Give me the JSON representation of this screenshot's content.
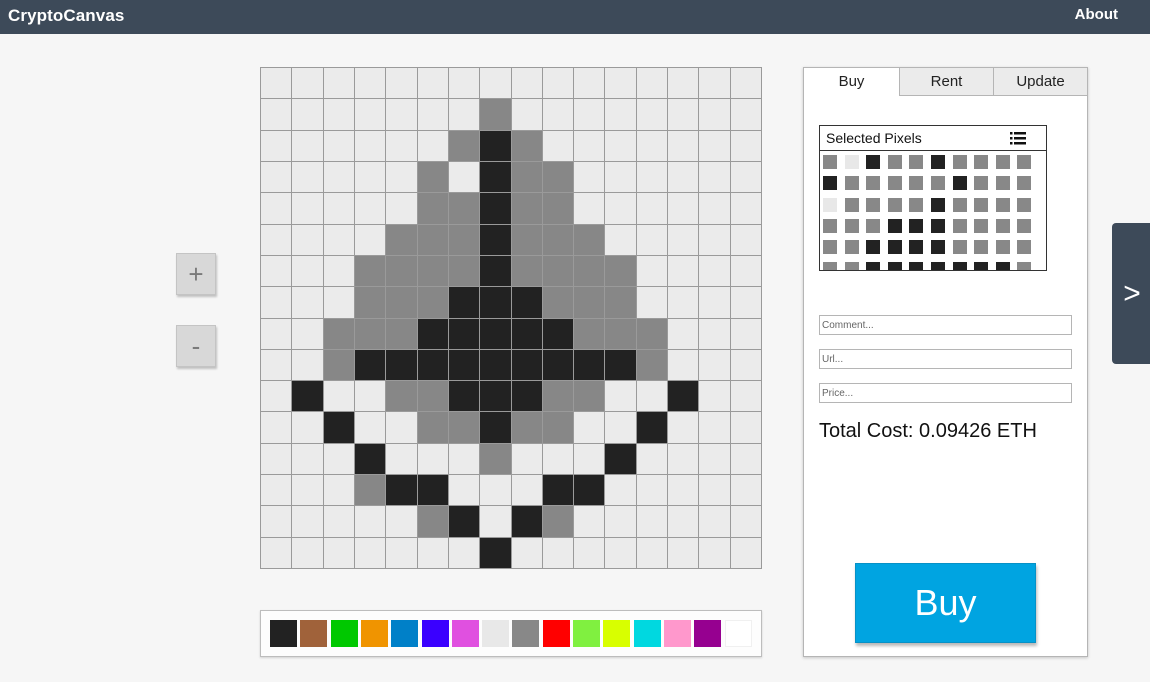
{
  "header": {
    "brand": "CryptoCanvas",
    "about": "About"
  },
  "zoom": {
    "in_label": "+",
    "out_label": "-"
  },
  "canvas": {
    "cols": 16,
    "rows": 16,
    "colors": {
      "L": "#ebebeb",
      "G": "#878787",
      "D": "#222222"
    },
    "pixels": [
      "LLLLLLLLLLLLLLLL",
      "LLLLLLLGLLLLLLLL",
      "LLLLLLGDGLLLLLLL",
      "LLLLLGLDGGLLLLLL",
      "LLLLLGGDGGLLLLLL",
      "LLLLGGGDGGGLLLLL",
      "LLLGGGGDGGGGLLLL",
      "LLLGGGDDDGGGLLLL",
      "LLGGGDDDDDGGGLLL",
      "LLGDDDDDDDDDGLLL",
      "LDLLGGDDDGGLLDLL",
      "LLDLLGGDGGLLDLLL",
      "LLLDLLLGLLLDLLLL",
      "LLLGDDLLLDDLLLLL",
      "LLLLLGDLDGLLLLLL",
      "LLLLLLLDLLLLLLLL"
    ]
  },
  "palette": {
    "colors": [
      "#222222",
      "#a0623a",
      "#00c800",
      "#f09400",
      "#0080c8",
      "#3a00ff",
      "#e050e0",
      "#e8e8e8",
      "#888888",
      "#ff0000",
      "#80f040",
      "#d8ff00",
      "#00d8e0",
      "#ff98cc",
      "#960090",
      "#ffffff"
    ]
  },
  "panel": {
    "tabs": [
      "Buy",
      "Rent",
      "Update"
    ],
    "selected": {
      "title": "Selected Pixels",
      "colors": {
        "L": "#e8e8e8",
        "G": "#888888",
        "D": "#222222"
      },
      "rows": [
        "GLDGGDGGGG",
        "DGGGGGDGGG",
        "LGGGGDGGGG",
        "GGGDDDGGGG",
        "GGDDDDGGGG",
        "GGDDDDDDDG"
      ]
    },
    "comment_placeholder": "Comment...",
    "url_placeholder": "Url...",
    "price_placeholder": "Price...",
    "total_cost": "Total Cost: 0.09426 ETH",
    "buy_label": "Buy"
  },
  "side_toggle": {
    "label": ">"
  }
}
